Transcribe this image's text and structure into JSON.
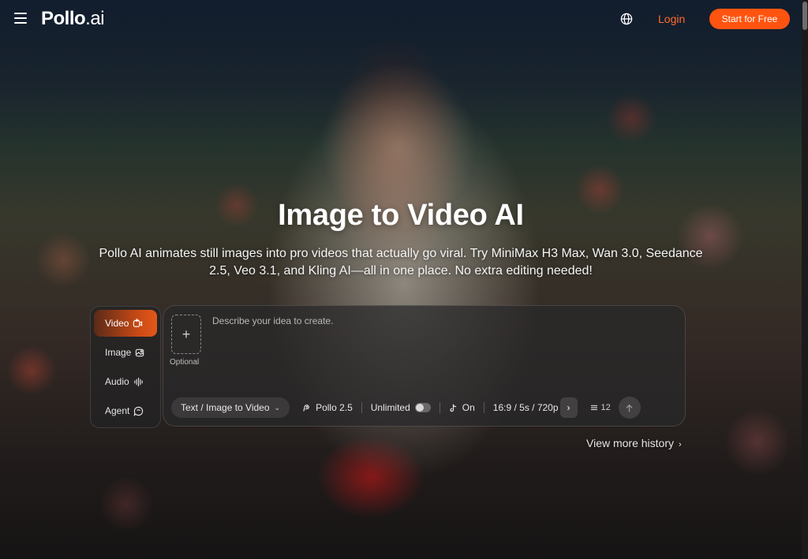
{
  "header": {
    "logo_main": "Pollo",
    "logo_suffix": ".ai",
    "login_label": "Login",
    "start_label": "Start for Free",
    "icons": {
      "menu": "hamburger-menu-icon",
      "language": "globe-icon"
    }
  },
  "hero": {
    "title": "Image to Video AI",
    "subtitle": "Pollo AI animates still images into pro videos that actually go viral. Try MiniMax H3 Max, Wan 3.0, Seedance 2.5, Veo 3.1, and Kling AI—all in one place. No extra editing needed!"
  },
  "mode_tabs": [
    {
      "label": "Video",
      "icon": "video-sparkle-icon",
      "active": true
    },
    {
      "label": "Image",
      "icon": "image-sparkle-icon",
      "active": false
    },
    {
      "label": "Audio",
      "icon": "audio-wave-icon",
      "active": false
    },
    {
      "label": "Agent",
      "icon": "agent-icon",
      "active": false
    }
  ],
  "prompt": {
    "upload_label": "Optional",
    "placeholder": "Describe your idea to create.",
    "value": ""
  },
  "toolbar": {
    "mode_select": "Text / Image to Video",
    "model": "Pollo 2.5",
    "unlimited_label": "Unlimited",
    "unlimited_on": false,
    "sound_label": "On",
    "settings": "16:9 / 5s / 720p",
    "credits": "12"
  },
  "history": {
    "label": "View more history"
  },
  "colors": {
    "accent": "#ff5410",
    "login": "#ff6a2b",
    "active_tab_start": "#5a2a18",
    "active_tab_end": "#e3581a"
  }
}
